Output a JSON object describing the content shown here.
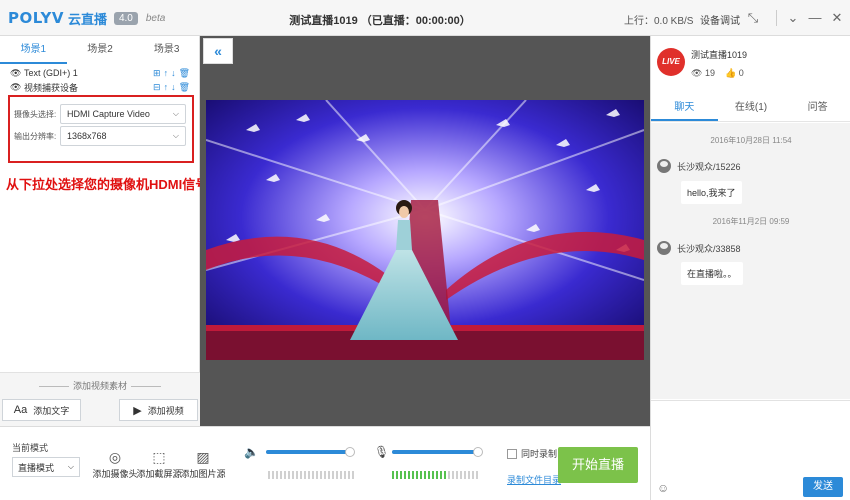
{
  "app": {
    "logo_text": "POLYV",
    "logo_cn": "云直播",
    "version": "4.0",
    "beta": "beta",
    "window_title": "测试直播1019 （已直播：00:00:00）",
    "upload_speed": "上行：0.0 KB/S",
    "device_settings": "设备调试"
  },
  "scenes": {
    "tabs": [
      "场景1",
      "场景2",
      "场景3"
    ],
    "active": 0
  },
  "layers": [
    {
      "name": "Text (GDI+) 1"
    },
    {
      "name": "视频捕获设备"
    }
  ],
  "device": {
    "camera_label": "摄像头选择:",
    "camera_value": "HDMI Capture Video",
    "resolution_label": "输出分辨率:",
    "resolution_value": "1368x768"
  },
  "tip": "从下拉处选择您的摄像机HDMI信号源",
  "add_source": {
    "label": "添加视频素材",
    "add_text": "添加文字",
    "add_video": "添加视频"
  },
  "bottom": {
    "mode_label": "当前模式",
    "mode_value": "直播模式",
    "tools": [
      "添加摄像头",
      "添加截屏源",
      "添加图片源"
    ],
    "speaker_level": 0.95,
    "mic_level": 0.95,
    "record_label": "同时录制",
    "record_dir": "录制文件目录",
    "start_button": "开始直播"
  },
  "chat": {
    "live_badge": "LIVE",
    "channel_title": "测试直播1019",
    "views": "19",
    "likes": "0",
    "tabs": [
      "聊天",
      "在线(1)",
      "问答"
    ],
    "active_tab": 0,
    "messages": [
      {
        "time": "2016年10月28日 11:54",
        "user": "长沙观众/15226",
        "text": "hello,我来了"
      },
      {
        "time": "2016年11月2日 09:59",
        "user": "长沙观众/33858",
        "text": "在直播啦。。"
      }
    ],
    "send_button": "发送"
  },
  "colors": {
    "accent": "#2c8ad8",
    "start_button": "#7cc24a",
    "tip_red": "#e01010",
    "live_red": "#e0302b"
  }
}
